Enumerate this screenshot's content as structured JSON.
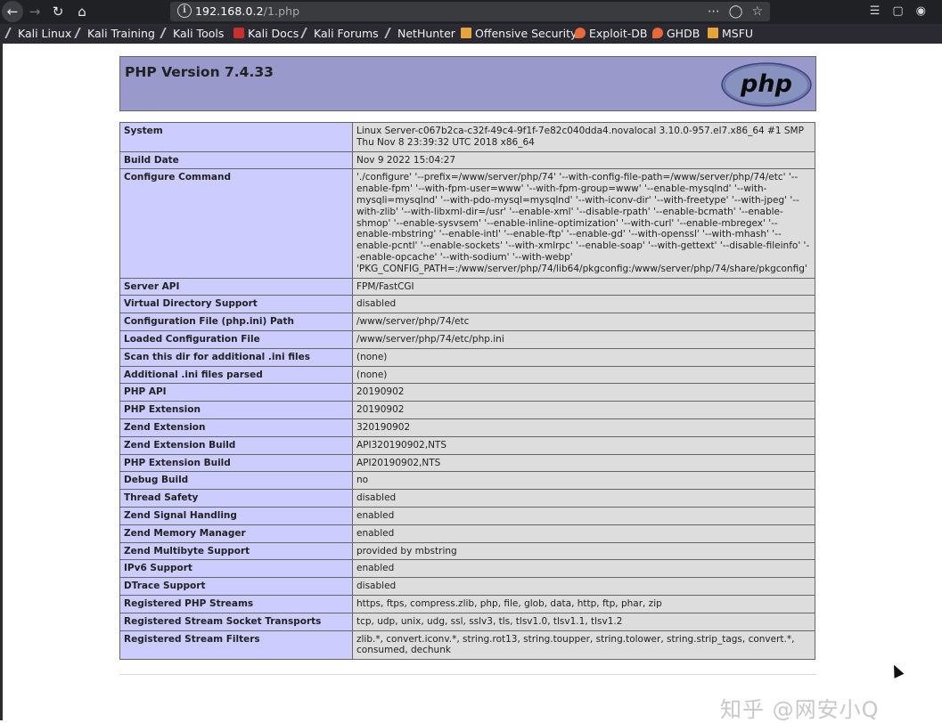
{
  "browser": {
    "url_host": "192.168.0.2",
    "url_path": "/1.php",
    "bookmarks": [
      {
        "label": "Kali Linux"
      },
      {
        "label": "Kali Training"
      },
      {
        "label": "Kali Tools"
      },
      {
        "label": "Kali Docs"
      },
      {
        "label": "Kali Forums"
      },
      {
        "label": "NetHunter"
      },
      {
        "label": "Offensive Security"
      },
      {
        "label": "Exploit-DB"
      },
      {
        "label": "GHDB"
      },
      {
        "label": "MSFU"
      }
    ]
  },
  "php": {
    "title": "PHP Version 7.4.33",
    "logo_text": "php",
    "rows": [
      {
        "k": "System",
        "v": "Linux Server-c067b2ca-c32f-49c4-9f1f-7e82c040dda4.novalocal 3.10.0-957.el7.x86_64 #1 SMP Thu Nov 8 23:39:32 UTC 2018 x86_64"
      },
      {
        "k": "Build Date",
        "v": "Nov 9 2022 15:04:27"
      },
      {
        "k": "Configure Command",
        "v": "'./configure' '--prefix=/www/server/php/74' '--with-config-file-path=/www/server/php/74/etc' '--enable-fpm' '--with-fpm-user=www' '--with-fpm-group=www' '--enable-mysqlnd' '--with-mysqli=mysqlnd' '--with-pdo-mysql=mysqlnd' '--with-iconv-dir' '--with-freetype' '--with-jpeg' '--with-zlib' '--with-libxml-dir=/usr' '--enable-xml' '--disable-rpath' '--enable-bcmath' '--enable-shmop' '--enable-sysvsem' '--enable-inline-optimization' '--with-curl' '--enable-mbregex' '--enable-mbstring' '--enable-intl' '--enable-ftp' '--enable-gd' '--with-openssl' '--with-mhash' '--enable-pcntl' '--enable-sockets' '--with-xmlrpc' '--enable-soap' '--with-gettext' '--disable-fileinfo' '--enable-opcache' '--with-sodium' '--with-webp' 'PKG_CONFIG_PATH=:/www/server/php/74/lib64/pkgconfig:/www/server/php/74/share/pkgconfig'"
      },
      {
        "k": "Server API",
        "v": "FPM/FastCGI"
      },
      {
        "k": "Virtual Directory Support",
        "v": "disabled"
      },
      {
        "k": "Configuration File (php.ini) Path",
        "v": "/www/server/php/74/etc"
      },
      {
        "k": "Loaded Configuration File",
        "v": "/www/server/php/74/etc/php.ini"
      },
      {
        "k": "Scan this dir for additional .ini files",
        "v": "(none)"
      },
      {
        "k": "Additional .ini files parsed",
        "v": "(none)"
      },
      {
        "k": "PHP API",
        "v": "20190902"
      },
      {
        "k": "PHP Extension",
        "v": "20190902"
      },
      {
        "k": "Zend Extension",
        "v": "320190902"
      },
      {
        "k": "Zend Extension Build",
        "v": "API320190902,NTS"
      },
      {
        "k": "PHP Extension Build",
        "v": "API20190902,NTS"
      },
      {
        "k": "Debug Build",
        "v": "no"
      },
      {
        "k": "Thread Safety",
        "v": "disabled"
      },
      {
        "k": "Zend Signal Handling",
        "v": "enabled"
      },
      {
        "k": "Zend Memory Manager",
        "v": "enabled"
      },
      {
        "k": "Zend Multibyte Support",
        "v": "provided by mbstring"
      },
      {
        "k": "IPv6 Support",
        "v": "enabled"
      },
      {
        "k": "DTrace Support",
        "v": "disabled"
      },
      {
        "k": "Registered PHP Streams",
        "v": "https, ftps, compress.zlib, php, file, glob, data, http, ftp, phar, zip"
      },
      {
        "k": "Registered Stream Socket Transports",
        "v": "tcp, udp, unix, udg, ssl, sslv3, tls, tlsv1.0, tlsv1.1, tlsv1.2"
      },
      {
        "k": "Registered Stream Filters",
        "v": "zlib.*, convert.iconv.*, string.rot13, string.toupper, string.tolower, string.strip_tags, convert.*, consumed, dechunk"
      }
    ]
  },
  "watermark": "知乎 @网安小Q",
  "colors": {
    "header_bg": "#9999cc",
    "key_bg": "#ccccff",
    "value_bg": "#dddddd",
    "border": "#666666"
  }
}
